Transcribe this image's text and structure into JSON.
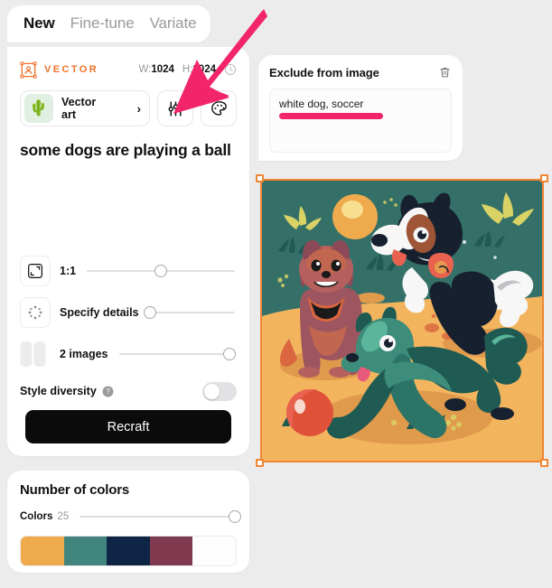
{
  "tabs": [
    {
      "label": "New",
      "active": true
    },
    {
      "label": "Fine-tune",
      "active": false
    },
    {
      "label": "Variate",
      "active": false
    }
  ],
  "generator": {
    "badge_label": "VECTOR",
    "badge_icon": "vector-frame-icon",
    "badge_color": "#f0712b",
    "width_label": "W:",
    "width_value": "1024",
    "height_label": "H:",
    "height_value": "1024",
    "history_icon": "clock-icon",
    "style": {
      "thumb_icon": "potted-plant-icon",
      "name_line1": "Vector",
      "name_line2": "art",
      "chevron": "›"
    },
    "settings_icon": "sliders-icon",
    "palette_icon": "palette-icon",
    "prompt": "some dogs are playing a ball",
    "controls": [
      {
        "label": "1:1",
        "icon": "aspect-ratio-icon",
        "value": 50
      },
      {
        "label": "Specify details",
        "icon": "details-dots-icon",
        "value": 0
      },
      {
        "label": "2 images",
        "icon": "two-images-icon",
        "value": 95
      }
    ],
    "style_diversity": {
      "label": "Style diversity",
      "help_icon": "question-mark-icon",
      "enabled": false
    },
    "recraft_button": "Recraft"
  },
  "colors_panel": {
    "title": "Number of colors",
    "colors_label": "Colors",
    "colors_value": "25",
    "slider_value": 100,
    "swatches": [
      "#eeaa4d",
      "#42847e",
      "#0e2546",
      "#7f3a50",
      "#fdfdfd"
    ]
  },
  "exclude_panel": {
    "title": "Exclude from image",
    "delete_icon": "trash-icon",
    "text": "white dog, soccer",
    "highlight_color": "#f2256b"
  },
  "image": {
    "alt": "three cartoon dogs playing with a ball in a desert scene",
    "selected": true,
    "selection_color": "#f08634",
    "handles": [
      "top-left",
      "top-right",
      "bottom-left",
      "bottom-right"
    ]
  },
  "annotation": {
    "arrow_color": "#f2256b",
    "points_at": "settings-sliders-button"
  }
}
